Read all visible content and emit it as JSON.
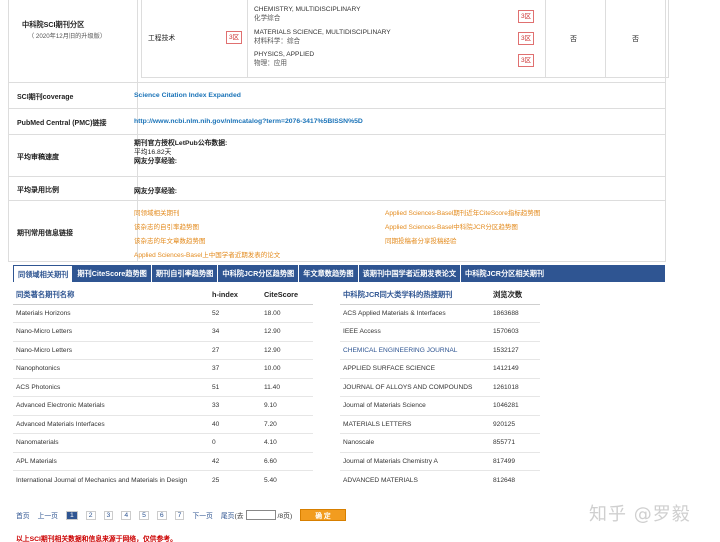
{
  "cas": {
    "title": "中科院SCI期刊分区",
    "subtitle": "（ 2020年12月旧的升级版）",
    "category": "工程技术",
    "category_zone": "3区",
    "subjects": [
      {
        "en": "CHEMISTRY, MULTIDISCIPLINARY",
        "cn": "化学综合",
        "zone": "3区"
      },
      {
        "en": "MATERIALS SCIENCE, MULTIDISCIPLINARY",
        "cn": "材料科学：综合",
        "zone": "3区"
      },
      {
        "en": "PHYSICS, APPLIED",
        "cn": "物理：应用",
        "zone": "3区"
      }
    ],
    "col3": "否",
    "col4": "否"
  },
  "rows": {
    "coverage_label": "SCI期刊coverage",
    "coverage_value": "Science Citation Index Expanded",
    "pmc_label": "PubMed Central (PMC)链接",
    "pmc_value": "http://www.ncbi.nlm.nih.gov/nlmcatalog?term=2076-3417%5BISSN%5D",
    "review_label": "平均审稿速度",
    "review_line1": "期刊官方授权LetPub公布数据:",
    "review_line2": "平均16.82天",
    "review_line3": "网友分享经验:",
    "accept_label": "平均录用比例",
    "accept_value": "网友分享经验:",
    "links_label": "期刊常用信息链接",
    "links_left": [
      "同领域相关期刊",
      "该杂志的自引率趋势图",
      "该杂志的年文章数趋势图",
      "Applied Sciences-Basel上中国学者近期发表的论文"
    ],
    "links_right": [
      "Applied Sciences-Basel期刊近年CiteScore指标趋势图",
      "Applied Sciences-Basel中科院JCR分区趋势图",
      "同期投稿者分享投稿经验"
    ]
  },
  "tabs": [
    "同领域相关期刊",
    "期刊CiteScore趋势图",
    "期刊自引率趋势图",
    "中科院JCR分区趋势图",
    "年文章数趋势图",
    "该期刊中国学者近期发表论文",
    "中科院JCR分区相关期刊"
  ],
  "left_table": {
    "headers": [
      "同类著名期刊名称",
      "h-index",
      "CiteScore"
    ],
    "rows": [
      [
        "Materials Horizons",
        "52",
        "18.00"
      ],
      [
        "Nano-Micro Letters",
        "34",
        "12.90"
      ],
      [
        "Nano-Micro Letters",
        "27",
        "12.90"
      ],
      [
        "Nanophotonics",
        "37",
        "10.00"
      ],
      [
        "ACS Photonics",
        "51",
        "11.40"
      ],
      [
        "Advanced Electronic Materials",
        "33",
        "9.10"
      ],
      [
        "Advanced Materials Interfaces",
        "40",
        "7.20"
      ],
      [
        "Nanomaterials",
        "0",
        "4.10"
      ],
      [
        "APL Materials",
        "42",
        "6.60"
      ],
      [
        "International Journal of Mechanics and Materials in Design",
        "25",
        "5.40"
      ]
    ]
  },
  "right_table": {
    "headers": [
      "中科院JCR同大类学科的热搜期刊",
      "浏览次数"
    ],
    "rows": [
      [
        "ACS Applied Materials & Interfaces",
        "1863688"
      ],
      [
        "IEEE Access",
        "1570603"
      ],
      [
        "CHEMICAL ENGINEERING JOURNAL",
        "1532127"
      ],
      [
        "APPLIED SURFACE SCIENCE",
        "1412149"
      ],
      [
        "JOURNAL OF ALLOYS AND COMPOUNDS",
        "1261018"
      ],
      [
        "Journal of Materials Science",
        "1046281"
      ],
      [
        "MATERIALS LETTERS",
        "920125"
      ],
      [
        "Nanoscale",
        "855771"
      ],
      [
        "Journal of Materials Chemistry A",
        "817499"
      ],
      [
        "ADVANCED MATERIALS",
        "812648"
      ]
    ]
  },
  "pager": {
    "first": "首页",
    "prev": "上一页",
    "pages": [
      "1",
      "2",
      "3",
      "4",
      "5",
      "6",
      "7"
    ],
    "current": "1",
    "next": "下一页",
    "last": "尾页",
    "goto_prefix": "(去",
    "goto_suffix": "/8页)",
    "ok": "确 定"
  },
  "footer": "以上SCI期刊相关数据和信息来源于网络，仅供参考。",
  "watermark": "知乎 @罗毅",
  "colors": {
    "accent": "#2f5592",
    "link": "#1a73b8",
    "orange": "#e38a1c",
    "zone_red": "#c33"
  }
}
